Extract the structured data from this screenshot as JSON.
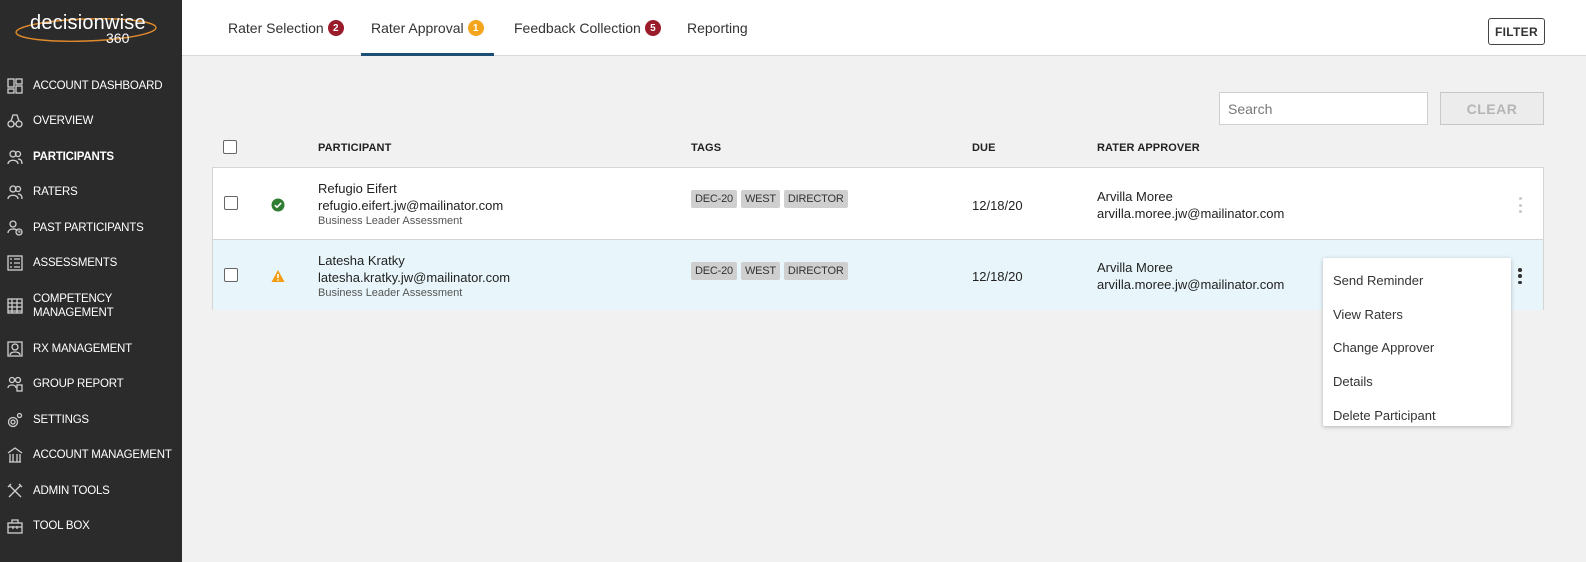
{
  "brand": {
    "name": "decisionwise",
    "suffix": "360"
  },
  "sidebar": {
    "items": [
      {
        "label": "ACCOUNT DASHBOARD",
        "icon": "dashboard-icon"
      },
      {
        "label": "OVERVIEW",
        "icon": "binoculars-icon"
      },
      {
        "label": "PARTICIPANTS",
        "icon": "people-icon",
        "active": true
      },
      {
        "label": "RATERS",
        "icon": "people-icon"
      },
      {
        "label": "PAST PARTICIPANTS",
        "icon": "people-history-icon"
      },
      {
        "label": "ASSESSMENTS",
        "icon": "list-icon"
      },
      {
        "label": "COMPETENCY\nMANAGEMENT",
        "icon": "grid-icon"
      },
      {
        "label": "RX MANAGEMENT",
        "icon": "person-card-icon"
      },
      {
        "label": "GROUP REPORT",
        "icon": "group-report-icon"
      },
      {
        "label": "SETTINGS",
        "icon": "gear-icon"
      },
      {
        "label": "ACCOUNT MANAGEMENT",
        "icon": "building-icon"
      },
      {
        "label": "ADMIN TOOLS",
        "icon": "tools-icon"
      },
      {
        "label": "TOOL BOX",
        "icon": "toolbox-icon"
      }
    ]
  },
  "tabs": [
    {
      "label": "Rater Selection",
      "badge": "2",
      "badge_color": "#9a1b2a"
    },
    {
      "label": "Rater Approval",
      "badge": "1",
      "badge_color": "#f3a51d",
      "active": true
    },
    {
      "label": "Feedback Collection",
      "badge": "5",
      "badge_color": "#9a1b2a"
    },
    {
      "label": "Reporting"
    }
  ],
  "filter_label": "FILTER",
  "search": {
    "placeholder": "Search"
  },
  "clear_label": "CLEAR",
  "table": {
    "columns": {
      "participant": "PARTICIPANT",
      "tags": "TAGS",
      "due": "DUE",
      "rater_approver": "RATER APPROVER"
    },
    "rows": [
      {
        "status": "approved",
        "name": "Refugio Eifert",
        "email": "refugio.eifert.jw@mailinator.com",
        "assessment": "Business Leader Assessment",
        "tags": [
          "DEC-20",
          "WEST",
          "DIRECTOR"
        ],
        "due": "12/18/20",
        "approver_name": "Arvilla Moree",
        "approver_email": "arvilla.moree.jw@mailinator.com"
      },
      {
        "status": "warning",
        "name": "Latesha Kratky",
        "email": "latesha.kratky.jw@mailinator.com",
        "assessment": "Business Leader Assessment",
        "tags": [
          "DEC-20",
          "WEST",
          "DIRECTOR"
        ],
        "due": "12/18/20",
        "approver_name": "Arvilla Moree",
        "approver_email": "arvilla.moree.jw@mailinator.com"
      }
    ]
  },
  "context_menu": {
    "items": [
      "Send Reminder",
      "View Raters",
      "Change Approver",
      "Details",
      "Delete Participant"
    ]
  },
  "colors": {
    "sidebar_bg": "#2b2b2b",
    "accent": "#1d4e73",
    "approved": "#2e7d32",
    "warning": "#f39c12",
    "selected_row": "#e8f6fb"
  }
}
